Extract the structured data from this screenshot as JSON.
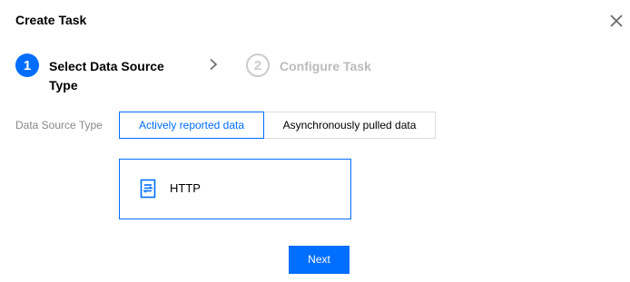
{
  "dialog": {
    "title": "Create Task",
    "close_icon": "close-icon"
  },
  "steps": [
    {
      "number": "1",
      "label": "Select Data Source Type",
      "state": "active"
    },
    {
      "number": "2",
      "label": "Configure Task",
      "state": "inactive"
    }
  ],
  "step_separator_icon": "chevron-right-icon",
  "form": {
    "data_source_type_label": "Data Source Type",
    "options": [
      {
        "label": "Actively reported data",
        "selected": true
      },
      {
        "label": "Asynchronously pulled data",
        "selected": false
      }
    ]
  },
  "card": {
    "icon": "document-icon",
    "label": "HTTP",
    "selected": true
  },
  "footer": {
    "next_label": "Next"
  },
  "colors": {
    "accent": "#006eff",
    "inactive_step": "#cccccc",
    "inactive_step_text": "#bbbbbb",
    "muted_label": "#888888",
    "border": "#dddddd"
  }
}
